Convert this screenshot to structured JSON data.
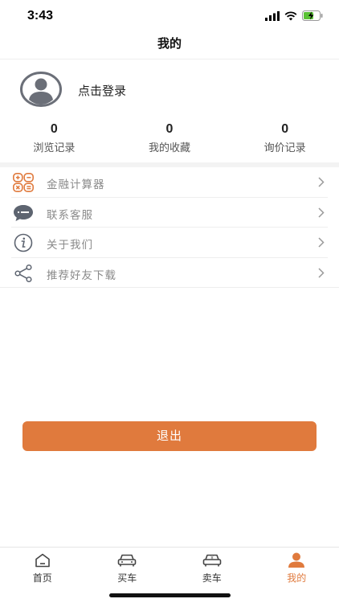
{
  "status_bar": {
    "time": "3:43"
  },
  "nav": {
    "title": "我的"
  },
  "profile": {
    "login_text": "点击登录"
  },
  "stats": [
    {
      "value": "0",
      "label": "浏览记录"
    },
    {
      "value": "0",
      "label": "我的收藏"
    },
    {
      "value": "0",
      "label": "询价记录"
    }
  ],
  "menu": [
    {
      "label": "金融计算器",
      "icon": "calculator-icon"
    },
    {
      "label": "联系客服",
      "icon": "chat-bubble-icon"
    },
    {
      "label": "关于我们",
      "icon": "info-icon"
    },
    {
      "label": "推荐好友下载",
      "icon": "share-icon"
    }
  ],
  "logout": {
    "label": "退出"
  },
  "tabs": [
    {
      "label": "首页",
      "icon": "home-icon"
    },
    {
      "label": "买车",
      "icon": "car-icon"
    },
    {
      "label": "卖车",
      "icon": "sell-car-icon"
    },
    {
      "label": "我的",
      "icon": "profile-icon",
      "active": true
    }
  ],
  "colors": {
    "accent": "#e07a3d",
    "text": "#222222",
    "muted": "#8a8a8a",
    "divider": "#eeeeee"
  }
}
